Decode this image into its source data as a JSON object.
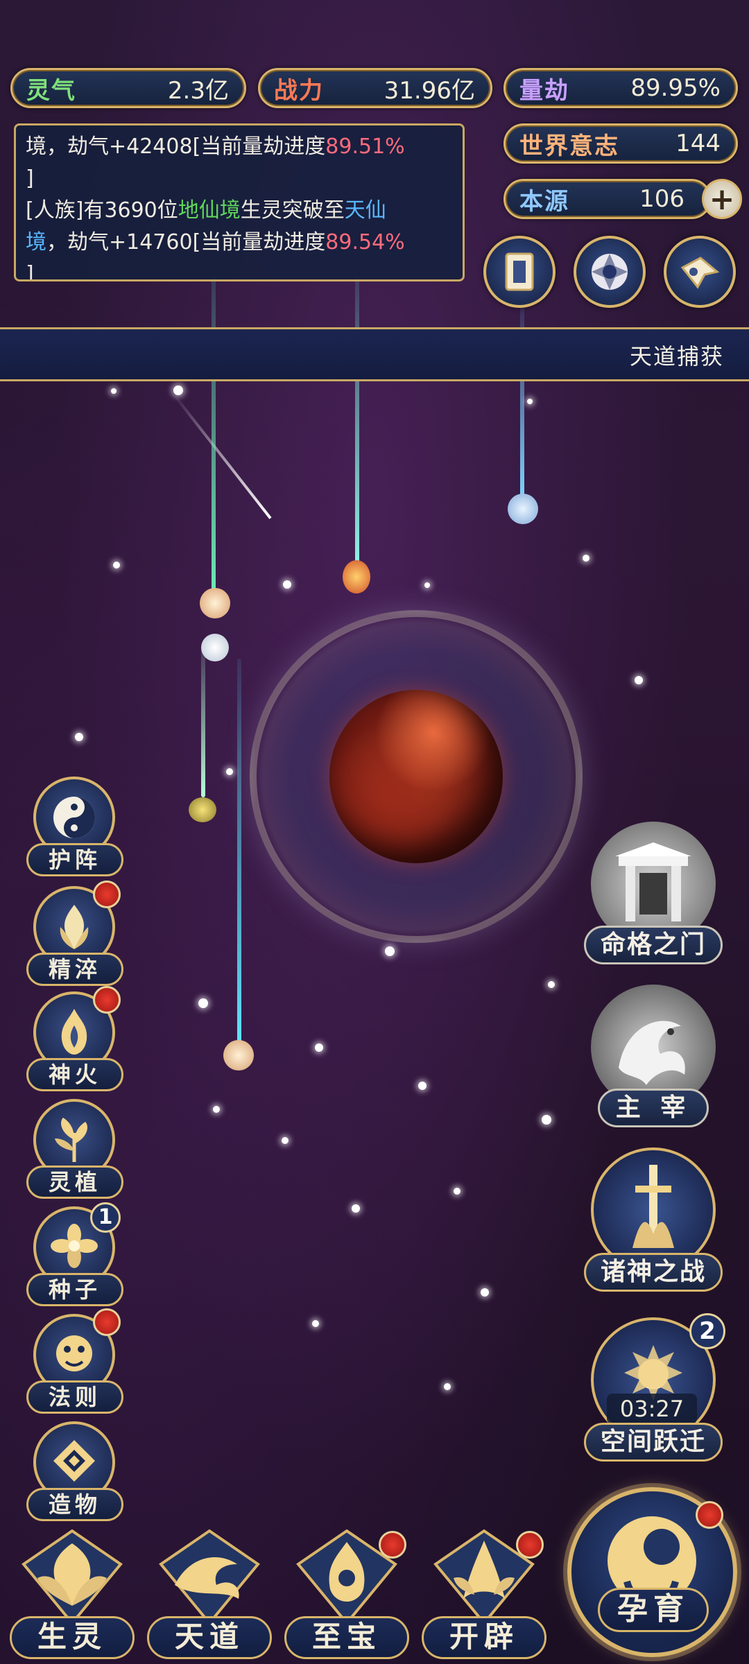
{
  "stats": {
    "lingqi": {
      "label": "灵气",
      "value": "2.3亿"
    },
    "zhanli": {
      "label": "战力",
      "value": "31.96亿"
    },
    "liangjie": {
      "label": "量劫",
      "value": "89.95%"
    },
    "shijie": {
      "label": "世界意志",
      "value": "144"
    },
    "benyuan": {
      "label": "本源",
      "value": "106"
    }
  },
  "log": {
    "line1_a": "境，劫气+42408[当前量劫进度",
    "line1_b": "89.51%",
    "line1_c": "]",
    "line2_a": "[人族]有3690位",
    "line2_b": "地仙境",
    "line2_c": "生灵突破至",
    "line2_d": "天仙",
    "line3_a": "境",
    "line3_b": "，劫气+14760[当前量劫进度",
    "line3_c": "89.54%",
    "line4": "]"
  },
  "ticker": {
    "text": "天道捕获"
  },
  "side_menu": [
    {
      "label": "护阵",
      "icon": "yin-yang-icon",
      "dot": false
    },
    {
      "label": "精淬",
      "icon": "flame-lotus-icon",
      "dot": true
    },
    {
      "label": "神火",
      "icon": "divine-fire-icon",
      "dot": true
    },
    {
      "label": "灵植",
      "icon": "spirit-plant-icon",
      "dot": false
    },
    {
      "label": "种子",
      "icon": "seed-flower-icon",
      "badge": "1"
    },
    {
      "label": "法则",
      "icon": "law-beast-icon",
      "dot": true
    },
    {
      "label": "造物",
      "icon": "creation-diamond-icon",
      "dot": false
    }
  ],
  "features": {
    "mingge": {
      "label": "命格之门",
      "icon": "gate-icon"
    },
    "zhuzai": {
      "label": "主 宰",
      "icon": "dragon-icon"
    },
    "zhushen": {
      "label": "诸神之战",
      "icon": "sword-icon"
    },
    "kongjian": {
      "label": "空间跃迁",
      "icon": "portal-icon",
      "badge": "2",
      "timer": "03:27"
    }
  },
  "bottom_nav": [
    {
      "label": "生灵",
      "icon": "phoenix-icon",
      "dot": false
    },
    {
      "label": "天道",
      "icon": "wave-icon",
      "dot": false
    },
    {
      "label": "至宝",
      "icon": "treasure-icon",
      "dot": true
    },
    {
      "label": "开辟",
      "icon": "axe-icon",
      "dot": true
    }
  ],
  "main_action": {
    "label": "孕育",
    "icon": "embryo-icon",
    "dot": true
  },
  "colors": {
    "gold": "#d9b56a",
    "panel": "#16223d",
    "accent_red": "#e83a2e"
  }
}
